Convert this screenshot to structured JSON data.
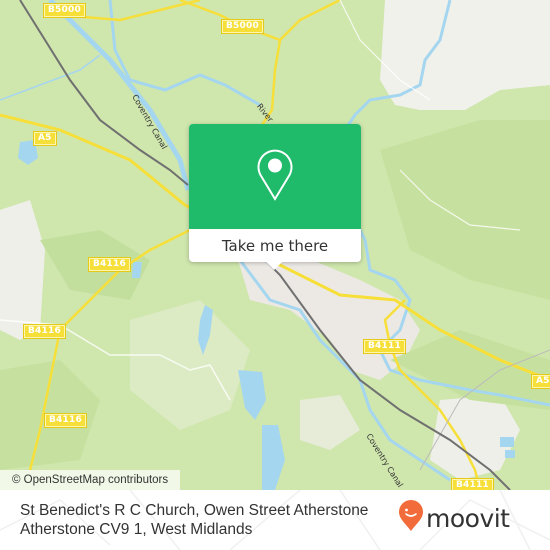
{
  "map": {
    "road_labels": [
      {
        "id": "b5000-west",
        "text": "B5000"
      },
      {
        "id": "b5000-east",
        "text": "B5000"
      },
      {
        "id": "a5-west",
        "text": "A5"
      },
      {
        "id": "b4116-north",
        "text": "B4116"
      },
      {
        "id": "b4116-mid",
        "text": "B4116"
      },
      {
        "id": "b4116-south",
        "text": "B4116"
      },
      {
        "id": "b4111-town",
        "text": "B4111"
      },
      {
        "id": "a5-east",
        "text": "A5"
      },
      {
        "id": "b4111-south",
        "text": "B4111"
      }
    ],
    "waterway_labels": [
      {
        "id": "coventry-canal-north",
        "text": "Coventry Canal"
      },
      {
        "id": "coventry-canal-south",
        "text": "Coventry Canal"
      },
      {
        "id": "river",
        "text": "River"
      }
    ],
    "colors": {
      "land": "#cfe6ad",
      "forest": "#c2df9c",
      "urban": "#efefea",
      "water": "#a5d6ef",
      "road": "#f7df3a",
      "railway": "#707070"
    }
  },
  "popup": {
    "icon": "map-pin-icon",
    "button_label": "Take me there",
    "accent": "#1fba6a"
  },
  "attribution": "© OpenStreetMap contributors",
  "footer": {
    "address": "St Benedict's R C Church, Owen Street Atherstone Atherstone CV9 1, West Midlands",
    "logo_text": "moovit",
    "logo_color": "#f26b3a"
  }
}
